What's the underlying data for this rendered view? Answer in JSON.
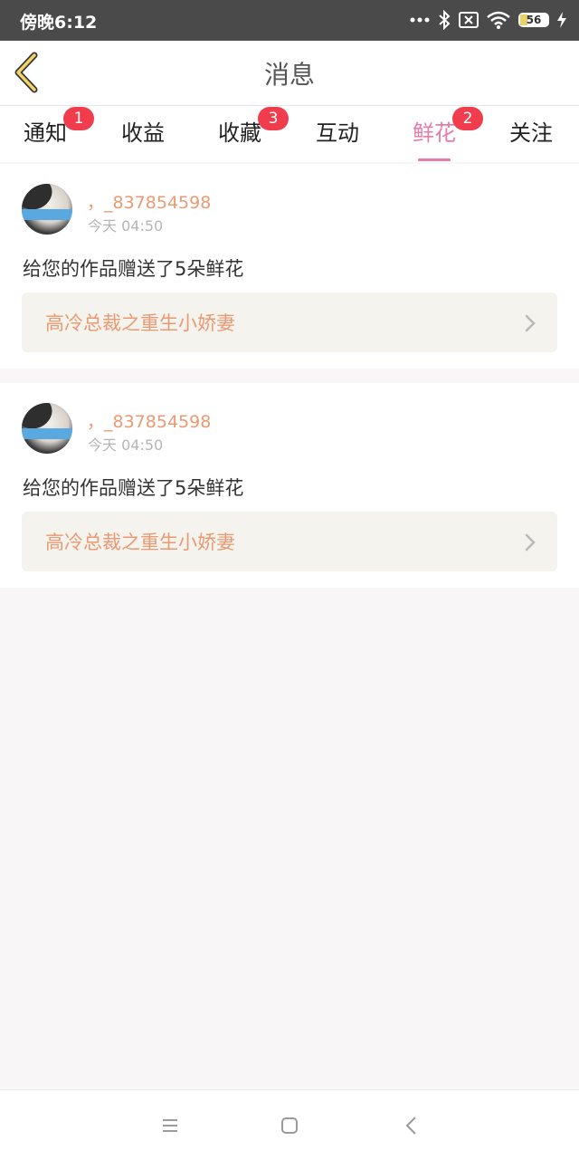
{
  "status_bar": {
    "time": "傍晚6:12",
    "battery": "56",
    "icons": [
      "more-dots-icon",
      "bluetooth-icon",
      "sim-x-icon",
      "wifi-icon",
      "battery-icon",
      "charging-icon"
    ]
  },
  "header": {
    "title": "消息",
    "back_icon": "chevron-left-icon"
  },
  "tabs": [
    {
      "label": "通知",
      "badge": "1"
    },
    {
      "label": "收益",
      "badge": ""
    },
    {
      "label": "收藏",
      "badge": "3"
    },
    {
      "label": "互动",
      "badge": ""
    },
    {
      "label": "鲜花",
      "badge": "2",
      "active": true
    },
    {
      "label": "关注",
      "badge": ""
    }
  ],
  "messages": [
    {
      "username": "，_837854598",
      "time": "今天 04:50",
      "text": "给您的作品赠送了5朵鲜花",
      "book": "高冷总裁之重生小娇妻"
    },
    {
      "username": "，_837854598",
      "time": "今天 04:50",
      "text": "给您的作品赠送了5朵鲜花",
      "book": "高冷总裁之重生小娇妻"
    }
  ],
  "colors": {
    "accent": "#e67aa9",
    "username": "#e99a73",
    "badge": "#f03c4c",
    "status_bar": "#4a4a4a"
  },
  "system_nav": [
    "menu-icon",
    "home-square-icon",
    "back-triangle-icon"
  ]
}
